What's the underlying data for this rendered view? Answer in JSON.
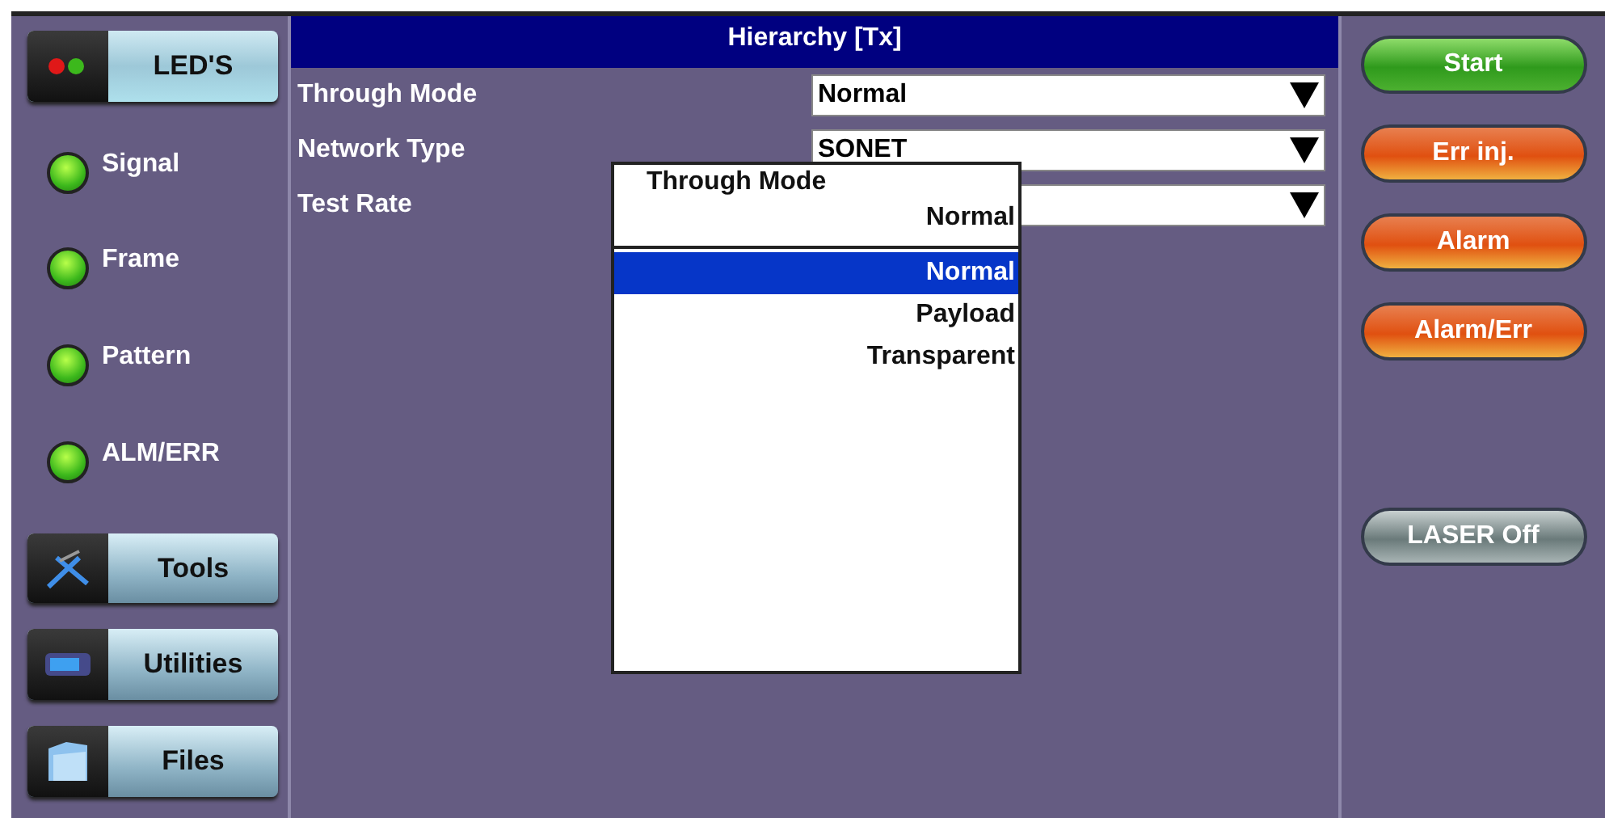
{
  "leds_button": {
    "label": "LED'S"
  },
  "leds": [
    {
      "label": "Signal",
      "on": true
    },
    {
      "label": "Frame",
      "on": true
    },
    {
      "label": "Pattern",
      "on": true
    },
    {
      "label": "ALM/ERR",
      "on": true
    }
  ],
  "nav_buttons": [
    {
      "label": "Tools",
      "kind": "tools"
    },
    {
      "label": "Utilities",
      "kind": "utilities"
    },
    {
      "label": "Files",
      "kind": "files"
    }
  ],
  "panel": {
    "title": "Hierarchy [Tx]",
    "fields": [
      {
        "label": "Through Mode",
        "value": "Normal"
      },
      {
        "label": "Network Type",
        "value": "SONET"
      },
      {
        "label": "Test Rate"
      }
    ]
  },
  "popup": {
    "title": "Through Mode",
    "current": "Normal",
    "options": [
      {
        "label": "Normal",
        "selected": true
      },
      {
        "label": "Payload",
        "selected": false
      },
      {
        "label": "Transparent",
        "selected": false
      }
    ]
  },
  "action_buttons": [
    {
      "label": "Start",
      "kind": "go"
    },
    {
      "label": "Err inj.",
      "kind": "warn"
    },
    {
      "label": "Alarm",
      "kind": "warn"
    },
    {
      "label": "Alarm/Err",
      "kind": "warn"
    },
    {
      "label": "LASER Off",
      "kind": "neutral"
    }
  ]
}
